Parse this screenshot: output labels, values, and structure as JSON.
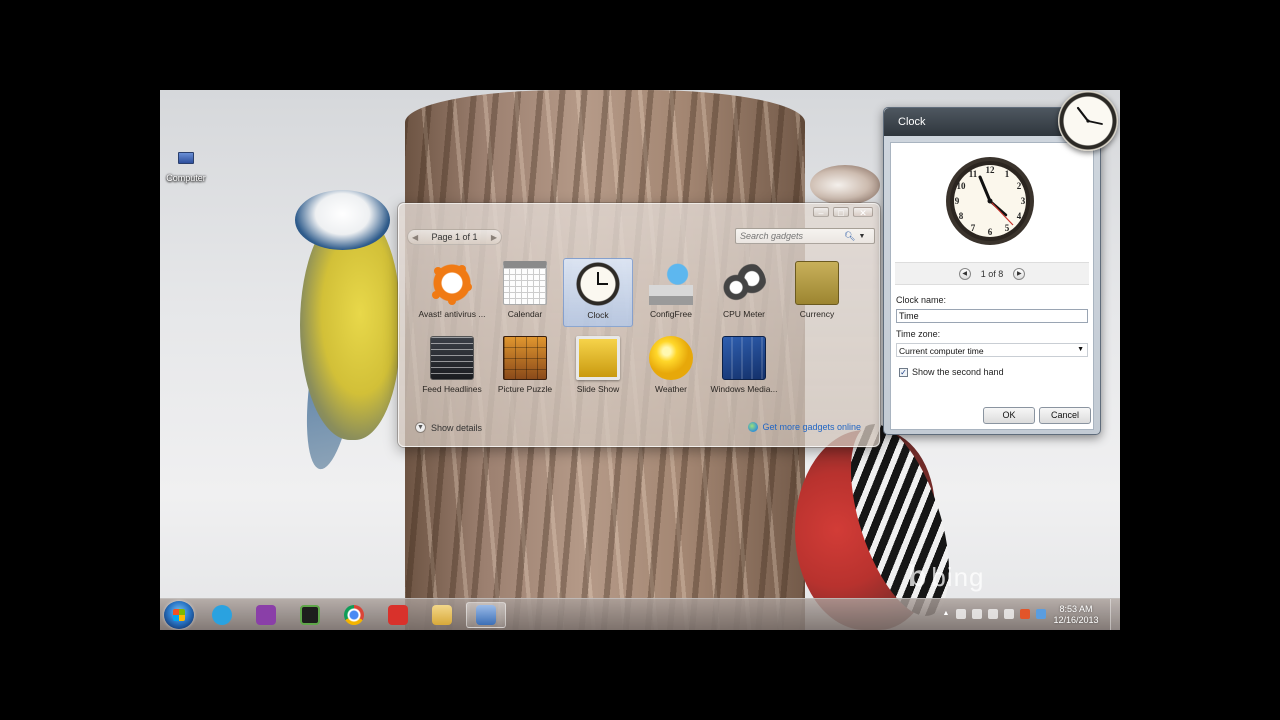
{
  "desktop": {
    "icons": [
      {
        "label": "Computer",
        "icon": "computer-icon"
      }
    ],
    "wallpaper_brand": "bing"
  },
  "gallery": {
    "pager_text": "Page 1 of 1",
    "search_placeholder": "Search gadgets",
    "controls": [
      "minimize",
      "maximize",
      "close"
    ],
    "gadgets": [
      {
        "name": "Avast! antivirus ...",
        "icon": "avast-icon",
        "selected": false
      },
      {
        "name": "Calendar",
        "icon": "calendar-icon",
        "selected": false
      },
      {
        "name": "Clock",
        "icon": "clock-icon",
        "selected": true
      },
      {
        "name": "ConfigFree",
        "icon": "configfree-icon",
        "selected": false
      },
      {
        "name": "CPU Meter",
        "icon": "cpu-meter-icon",
        "selected": false
      },
      {
        "name": "Currency",
        "icon": "currency-icon",
        "selected": false
      },
      {
        "name": "Feed Headlines",
        "icon": "feed-headlines-icon",
        "selected": false
      },
      {
        "name": "Picture Puzzle",
        "icon": "picture-puzzle-icon",
        "selected": false
      },
      {
        "name": "Slide Show",
        "icon": "slide-show-icon",
        "selected": false
      },
      {
        "name": "Weather",
        "icon": "weather-icon",
        "selected": false
      },
      {
        "name": "Windows Media...",
        "icon": "windows-media-center-icon",
        "selected": false
      }
    ],
    "show_details": "Show details",
    "get_more": "Get more gadgets online"
  },
  "clock_dialog": {
    "title": "Clock",
    "preview_nav": "1 of 8",
    "clock_name_label": "Clock name:",
    "clock_name_value": "Time",
    "time_zone_label": "Time zone:",
    "time_zone_value": "Current computer time",
    "second_hand_label": "Show the second hand",
    "second_hand_checked": true,
    "ok_label": "OK",
    "cancel_label": "Cancel"
  },
  "taskbar": {
    "apps": [
      {
        "name": "Skype",
        "icon": "skype-icon",
        "color": "#2aa2e0",
        "active": false
      },
      {
        "name": "OneNote",
        "icon": "onenote-icon",
        "color": "#8a3fa8",
        "active": false
      },
      {
        "name": "Camera",
        "icon": "camera-icon",
        "color": "#1d1d1d",
        "active": false
      },
      {
        "name": "Chrome",
        "icon": "chrome-icon",
        "color": "#db4437",
        "active": false
      },
      {
        "name": "Downloader",
        "icon": "download-icon",
        "color": "#d9312b",
        "active": false
      },
      {
        "name": "Explorer",
        "icon": "folder-icon",
        "color": "#e9c46a",
        "active": false
      },
      {
        "name": "Gadgets",
        "icon": "gadgets-icon",
        "color": "#5a8fd0",
        "active": true
      }
    ],
    "time": "8:53 AM",
    "date": "12/16/2013"
  }
}
